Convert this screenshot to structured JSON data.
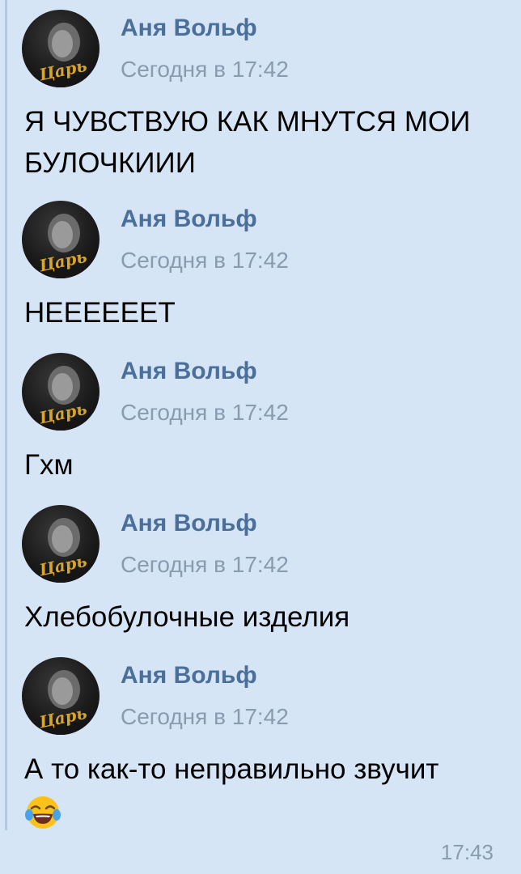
{
  "messages": [
    {
      "author": "Аня Вольф",
      "time": "Сегодня в 17:42",
      "text": "Я ЧУВСТВУЮ КАК МНУТСЯ МОИ БУЛОЧКИИИ"
    },
    {
      "author": "Аня Вольф",
      "time": "Сегодня в 17:42",
      "text": "НЕЕЕЕЕЕТ"
    },
    {
      "author": "Аня Вольф",
      "time": "Сегодня в 17:42",
      "text": "Гхм"
    },
    {
      "author": "Аня Вольф",
      "time": "Сегодня в 17:42",
      "text": "Хлебобулочные изделия"
    },
    {
      "author": "Аня Вольф",
      "time": "Сегодня в 17:42",
      "text": "А то как-то неправильно звучит",
      "emoji": "tears-of-joy-emoji"
    }
  ],
  "avatar_caption": "Царь",
  "send_time": "17:43"
}
